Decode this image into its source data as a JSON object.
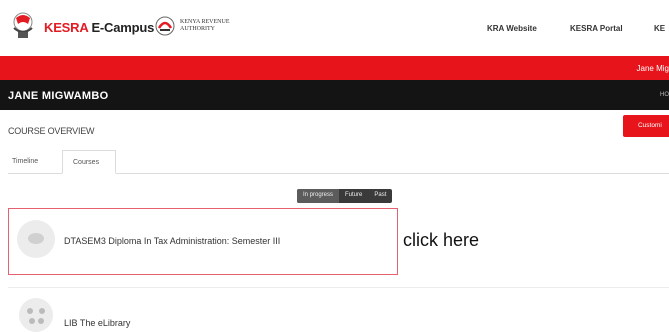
{
  "header": {
    "brand_red": "KESRA",
    "brand_dark": " E-Campus",
    "kra_text": "KENYA REVENUE AUTHORITY",
    "nav": [
      "KRA Website",
      "KESRA Portal",
      "KE"
    ]
  },
  "redbar": {
    "user_text": "Jane Mig"
  },
  "user_bar": {
    "name": "JANE MIGWAMBO",
    "right_text": "HO"
  },
  "page": {
    "title": "COURSE OVERVIEW",
    "customise_label": "Customi"
  },
  "tabs": [
    "Timeline",
    "Courses"
  ],
  "filter": [
    "In progress",
    "Future",
    "Past"
  ],
  "courses": [
    {
      "title": "DTASEM3 Diploma In Tax Administration: Semester III"
    },
    {
      "title": "LIB The eLibrary"
    }
  ],
  "annotation": "click here",
  "colors": {
    "accent_red": "#e8141c",
    "dark_bar": "#141414"
  }
}
